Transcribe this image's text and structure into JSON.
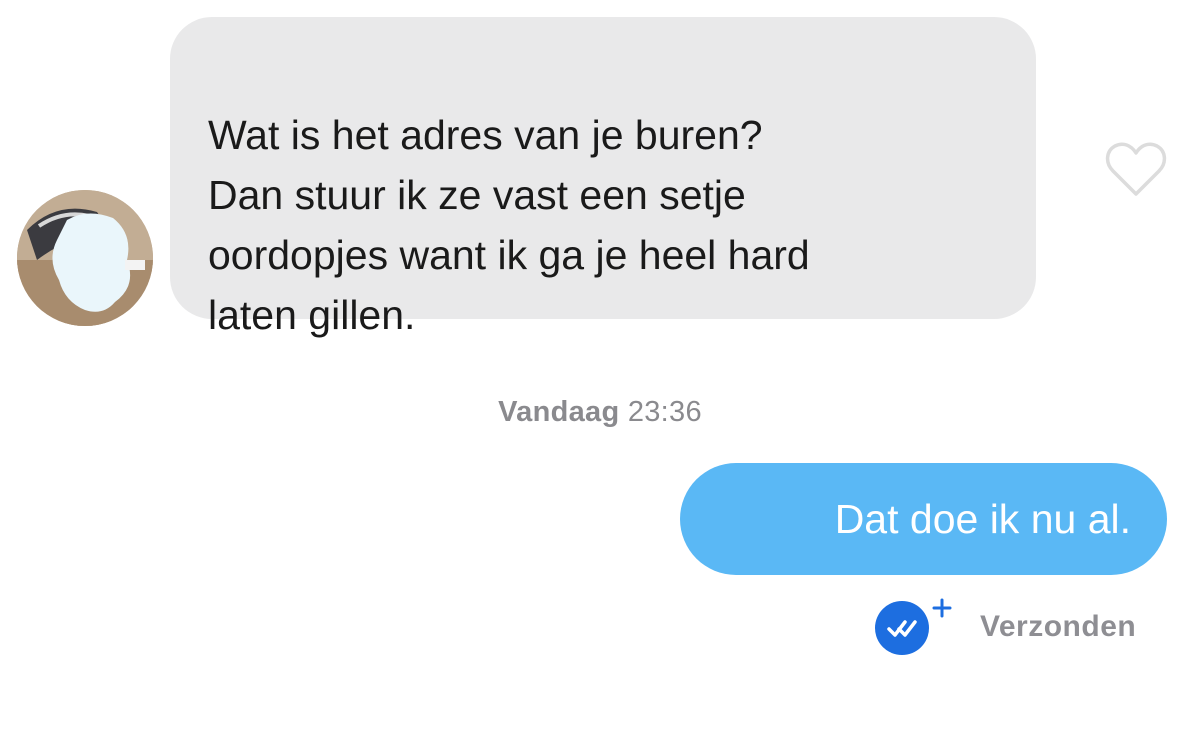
{
  "messages": {
    "incoming": {
      "text": "Wat is het adres van je buren?\nDan stuur ik ze vast een setje\noordopjes want ik ga je heel hard\nlaten gillen."
    },
    "timestamp": {
      "day": "Vandaag",
      "time": "23:36"
    },
    "outgoing": {
      "text": "Dat doe ik nu al."
    },
    "status": {
      "label": "Verzonden"
    }
  },
  "icons": {
    "like": "heart-outline-icon",
    "status": "double-check-plus-icon",
    "avatar": "avatar"
  },
  "colors": {
    "incoming_bubble": "#e9e9ea",
    "outgoing_bubble": "#5ab8f5",
    "status_badge": "#1d6ee0",
    "muted_text": "#8a8a8e"
  }
}
